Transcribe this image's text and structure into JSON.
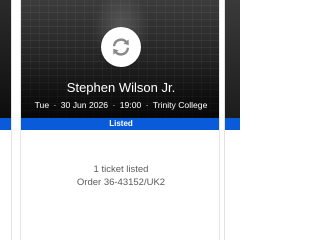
{
  "event": {
    "artist": "Stephen Wilson Jr.",
    "day": "Tue",
    "date": "30 Jun 2026",
    "time": "19:00",
    "venue": "Trinity College",
    "separator": "·"
  },
  "listing": {
    "status": "Listed",
    "ticket_count": "1 ticket listed",
    "order": "Order 36-43152/UK2"
  },
  "icons": {
    "refresh": "refresh-icon"
  },
  "colors": {
    "status_blue": "#0a5bd9",
    "text_muted": "#5b5b5b",
    "card_bg": "#ffffff"
  }
}
